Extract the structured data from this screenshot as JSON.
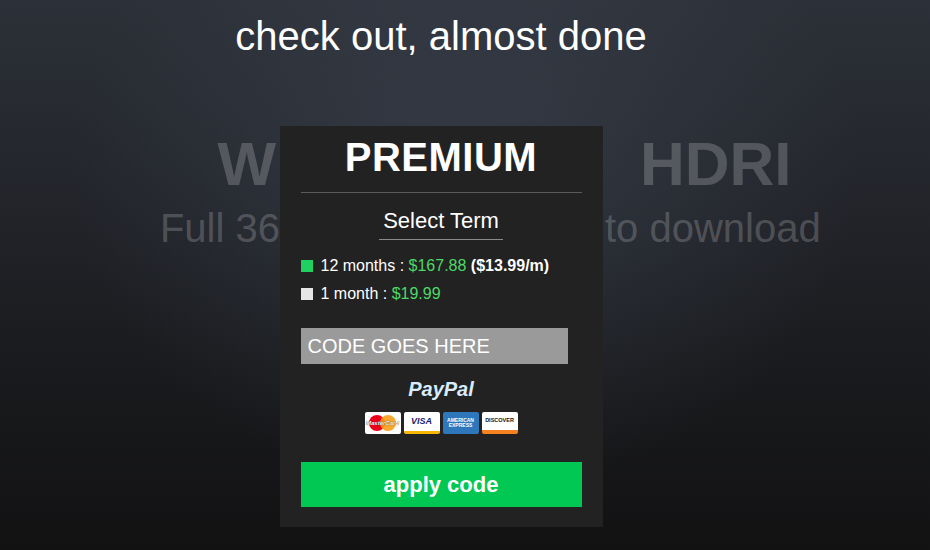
{
  "heading": "check out, almost done",
  "hero": {
    "title": [
      "W",
      "HDRI"
    ],
    "subtitle": [
      "Full 36",
      "to download"
    ]
  },
  "plan": {
    "title": "PREMIUM",
    "term_label": "Select Term",
    "terms": [
      {
        "label": "12 months :",
        "price": "$167.88",
        "per_month": "($13.99/m)",
        "selected": true
      },
      {
        "label": "1 month :",
        "price": "$19.99",
        "selected": false
      }
    ]
  },
  "code_field": {
    "value": "CODE GOES HERE"
  },
  "paypal": "PayPal",
  "cards": [
    {
      "label": "MasterCard",
      "kind": "mastercard",
      "color": "#eb001b"
    },
    {
      "label": "VISA",
      "kind": "visa",
      "color": "#1a1f71"
    },
    {
      "label": "AMERICAN EXPRESS",
      "kind": "amex",
      "color": "#2e77bb"
    },
    {
      "label": "DISCOVER",
      "kind": "discover",
      "color": "#f58220"
    }
  ],
  "button": "apply code"
}
